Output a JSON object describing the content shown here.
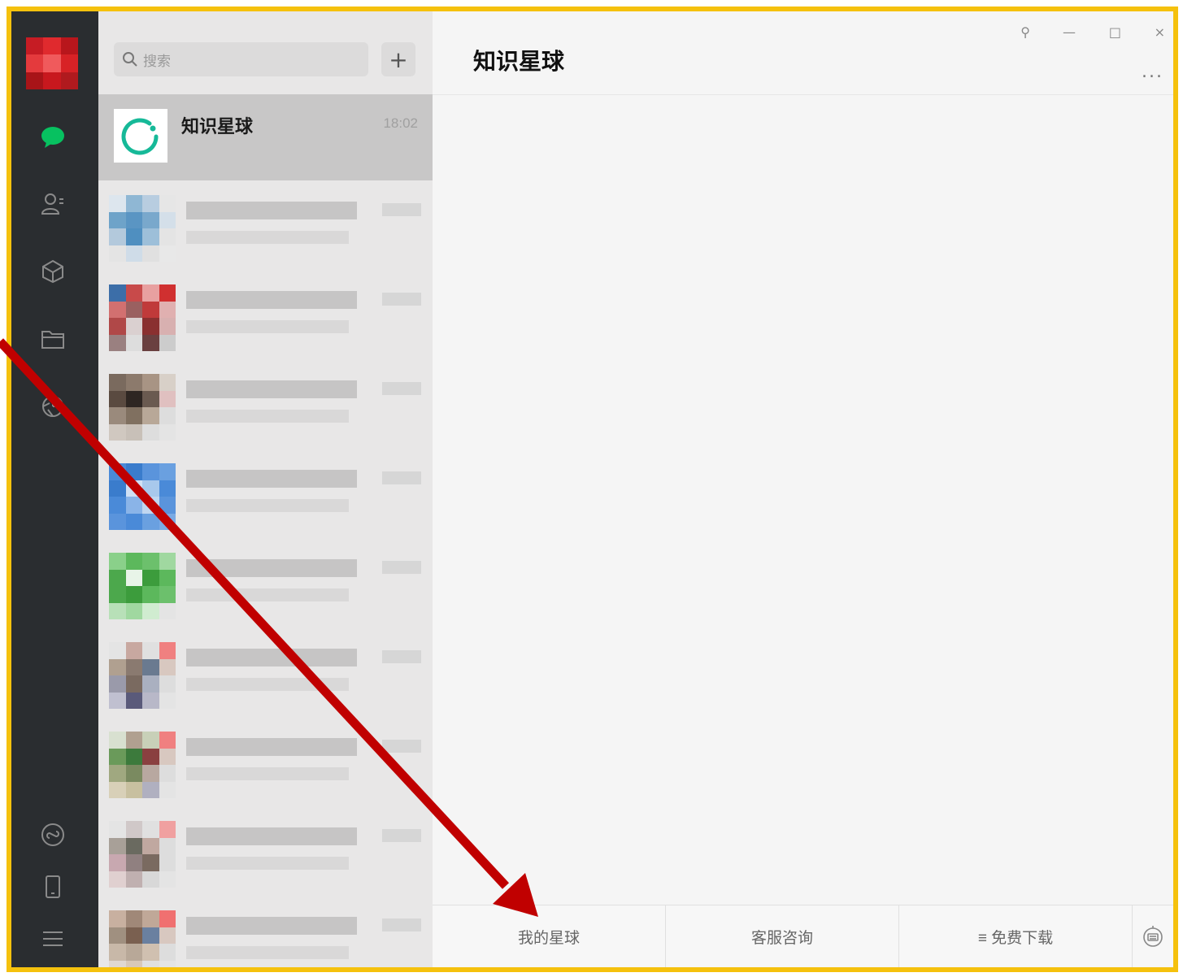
{
  "search": {
    "placeholder": "搜索"
  },
  "active_chat": {
    "name": "知识星球",
    "time": "18:02"
  },
  "header": {
    "title": "知识星球",
    "more": "..."
  },
  "window_controls": {
    "pin": "⚲",
    "minimize": "—",
    "maximize": "□",
    "close": "×"
  },
  "bottom_menu": {
    "my_planet": "我的星球",
    "support": "客服咨询",
    "download": "≡ 免费下载"
  },
  "colors": {
    "frame": "#f5c10d",
    "arrow": "#c00000",
    "accent": "#07c160"
  },
  "icons": [
    "chat-icon",
    "contacts-icon",
    "favorites-icon",
    "files-icon",
    "moments-icon",
    "miniprogram-icon",
    "phone-icon",
    "menu-icon",
    "keyboard-icon"
  ]
}
